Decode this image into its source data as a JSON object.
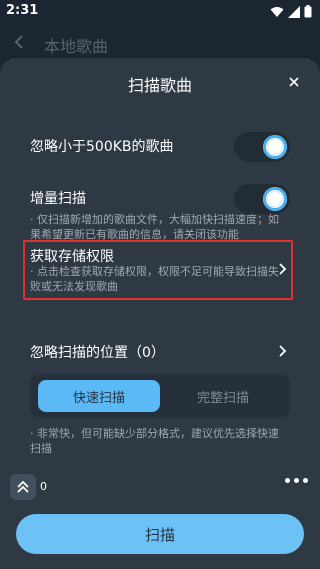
{
  "status_bar": {
    "time": "2:31"
  },
  "background_page": {
    "title": "本地歌曲"
  },
  "sheet": {
    "title": "扫描歌曲",
    "ignore_small": {
      "label": "忽略小于500KB的歌曲",
      "enabled": true
    },
    "incremental": {
      "label": "增量扫描",
      "enabled": true,
      "description": "· 仅扫描新增加的歌曲文件，大幅加快扫描速度；如果希望更新已有歌曲的信息，请关闭该功能"
    },
    "storage_permission": {
      "label": "获取存储权限",
      "description": "· 点击检查获取存储权限，权限不足可能导致扫描失败或无法发现歌曲"
    },
    "ignored_locations": {
      "label": "忽略扫描的位置（0）"
    },
    "scan_modes": {
      "quick": "快速扫描",
      "full": "完整扫描",
      "selected": "quick"
    },
    "mode_note": "· 非常快，但可能缺少部分格式，建议优先选择快速扫描",
    "footer_count": "0",
    "scan_button": "扫描"
  },
  "colors": {
    "accent": "#5bbaf6",
    "highlight_border": "#e03030",
    "sheet_bg": "#2f3943"
  }
}
